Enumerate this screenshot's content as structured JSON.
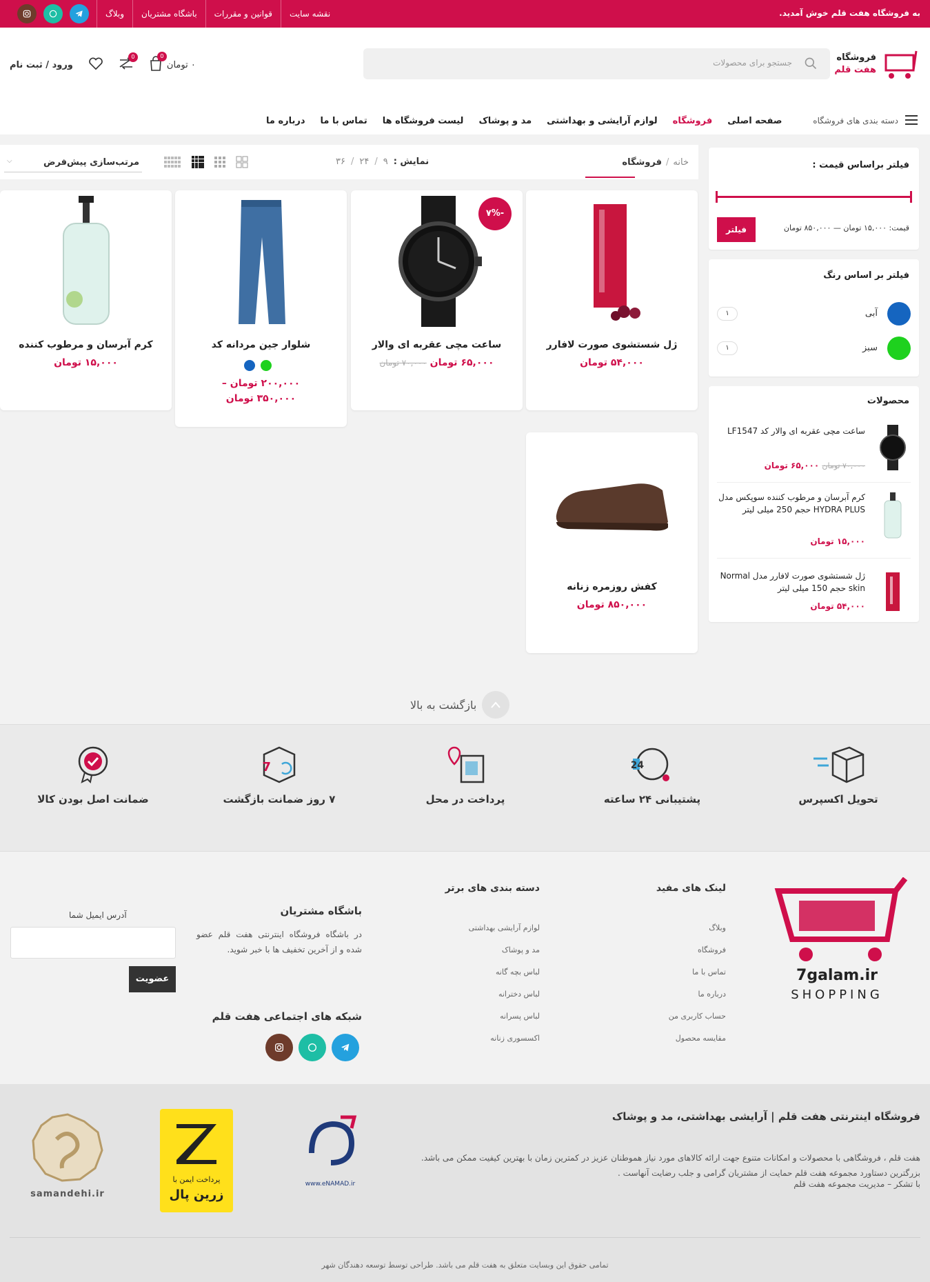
{
  "topbar": {
    "welcome": "به فروشگاه هفت قلم خوش آمدید.",
    "links": [
      "نقشه سایت",
      "قوانین و مقررات",
      "باشگاه مشتریان",
      "وبلاگ"
    ]
  },
  "header": {
    "logo_line1": "فروشگاه",
    "logo_line2": "هفت قلم",
    "search_placeholder": "جستجو برای محصولات",
    "login": "ورود / ثبت نام",
    "wishlist_count": "0",
    "compare_count": "0",
    "cart_count": "0",
    "cart_total": "۰ تومان"
  },
  "nav": {
    "categories": "دسته بندی های فروشگاه",
    "items": [
      "صفحه اصلی",
      "فروشگاه",
      "لوازم آرایشی و بهداشتی",
      "مد و پوشاک",
      "لیست فروشگاه ها",
      "تماس با ما",
      "درباره ما"
    ]
  },
  "toolbar": {
    "breadcrumb_home": "خانه",
    "breadcrumb_sep": "/",
    "breadcrumb_current": "فروشگاه",
    "show_label": "نمایش :",
    "counts": [
      "۹",
      "۲۴",
      "۳۶"
    ],
    "sort_label": "مرتب‌سازی پیش‌فرض"
  },
  "sidebar": {
    "price_title": "فیلتر براساس قیمت :",
    "price_range": "قیمت: ۱۵,۰۰۰ تومان — ۸۵۰,۰۰۰ تومان",
    "filter_button": "فیلتر",
    "color_title": "فیلتر بر اساس رنگ",
    "colors": [
      {
        "name": "آبی",
        "count": "۱",
        "hex": "#1565c0"
      },
      {
        "name": "سبز",
        "count": "۱",
        "hex": "#1ed11e"
      }
    ],
    "products_title": "محصولات",
    "products": [
      {
        "title": "ساعت مچی عقربه ای والار کد LF1547",
        "old_price": "۷۰,۰۰۰ تومان",
        "price": "۶۵,۰۰۰ تومان"
      },
      {
        "title": "کرم آبرسان و مرطوب کننده سوپکس مدل HYDRA PLUS حجم 250 میلی لیتر",
        "old_price": "",
        "price": "۱۵,۰۰۰ تومان"
      },
      {
        "title": "ژل شستشوی صورت لافارر مدل Normal skin حجم 150 میلی لیتر",
        "old_price": "",
        "price": "۵۴,۰۰۰ تومان"
      }
    ]
  },
  "products": [
    {
      "title": "ژل شستشوی صورت لافارر",
      "price": "۵۴,۰۰۰ تومان",
      "old_price": "",
      "sale": ""
    },
    {
      "title": "ساعت مچی عقربه ای والار",
      "price": "۶۵,۰۰۰ تومان",
      "old_price": "۷۰,۰۰۰ تومان",
      "sale": "-۷%"
    },
    {
      "title": "شلوار جین مردانه کد",
      "price": "۲۰۰,۰۰۰ تومان –",
      "price2": "۳۵۰,۰۰۰ تومان",
      "old_price": "",
      "sale": ""
    },
    {
      "title": "کرم آبرسان و مرطوب کننده",
      "price": "۱۵,۰۰۰ تومان",
      "old_price": "",
      "sale": ""
    },
    {
      "title": "کفش روزمره زنانه",
      "price": "۸۵۰,۰۰۰ تومان",
      "old_price": "",
      "sale": ""
    }
  ],
  "back_to_top": "بازگشت به بالا",
  "features": [
    "تحویل اکسپرس",
    "پشتیبانی ۲۴ ساعته",
    "پرداخت در محل",
    "۷ روز ضمانت بازگشت",
    "ضمانت اصل بودن کالا"
  ],
  "footer": {
    "logo_text": "7galam.ir",
    "logo_sub": "SHOPPING",
    "useful_title": "لینک های مفید",
    "useful_links": [
      "وبلاگ",
      "فروشگاه",
      "تماس با ما",
      "درباره ما",
      "حساب کاربری من",
      "مقایسه محصول"
    ],
    "cats_title": "دسته بندی های برتر",
    "cats_links": [
      "لوازم آرایشی بهداشتی",
      "مد و پوشاک",
      "لباس بچه گانه",
      "لباس دخترانه",
      "لباس پسرانه",
      "اکسسوری زنانه"
    ],
    "club_title": "باشگاه مشتریان",
    "club_text": "در باشگاه فروشگاه اینترنتی هفت قلم عضو شده و از آخرین تخفیف ها با خبر شوید.",
    "email_label": "آدرس ایمیل شما",
    "subscribe": "عضویت",
    "social_title": "شبکه های اجتماعی هفت قلم",
    "about_title": "فروشگاه اینترنتی هفت قلم | آرایشی بهداشتی، مد و پوشاک",
    "about_text": "هفت قلم ، فروشگاهی با محصولات و امکانات متنوع جهت ارائه کالاهای مورد نیاز هموطنان عزیز در کمترین زمان با بهترین کیفیت ممکن می باشد. بزرگترین دستاورد مجموعه هفت قلم حمایت از مشتریان گرامی و جلب رضایت آنهاست .",
    "about_sign": "با تشکر – مدیریت مجموعه هفت قلم",
    "zarinpal_line1": "پرداخت ایمن با",
    "zarinpal_line2": "زرین پال",
    "enamad": "www.eNAMAD.ir",
    "samandehi": "samandehi.ir",
    "copyright": "تمامی حقوق این وبسایت متعلق به هفت قلم می باشد. طراحی توسط توسعه دهندگان شهر"
  },
  "colors": {
    "accent": "#cf0f4b"
  }
}
